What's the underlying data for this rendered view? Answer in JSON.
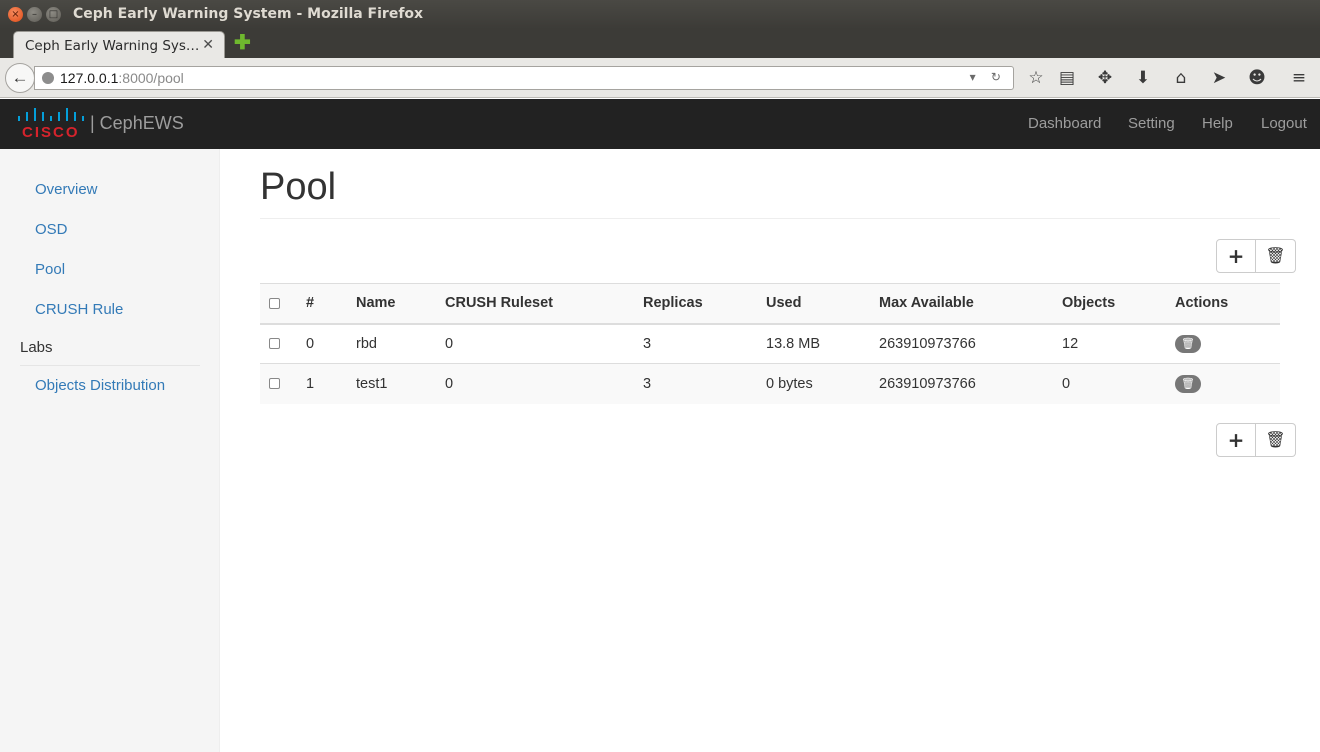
{
  "window": {
    "title": "Ceph Early Warning System - Mozilla Firefox"
  },
  "browser": {
    "tab_title": "Ceph Early Warning Sys…",
    "url_host": "127.0.0.1",
    "url_rest": ":8000/pool",
    "icons": [
      "back-arrow-icon",
      "globe-icon",
      "dropdown-icon",
      "reload-icon",
      "bookmark-star-icon",
      "reading-list-icon",
      "pocket-icon",
      "download-icon",
      "home-icon",
      "send-icon",
      "chat-icon",
      "menu-icon"
    ]
  },
  "app": {
    "brand_logo_text": "CISCO",
    "brand_name": "| CephEWS",
    "top_nav": [
      "Dashboard",
      "Setting",
      "Help",
      "Logout"
    ]
  },
  "sidebar": {
    "items": [
      "Overview",
      "OSD",
      "Pool",
      "CRUSH Rule"
    ],
    "section_header": "Labs",
    "lab_items": [
      "Objects Distribution"
    ]
  },
  "main": {
    "title": "Pool",
    "add_glyph": "+",
    "delete_glyph": "🗑",
    "table": {
      "headers": [
        "#",
        "Name",
        "CRUSH Ruleset",
        "Replicas",
        "Used",
        "Max Available",
        "Objects",
        "Actions"
      ],
      "rows": [
        {
          "id": "0",
          "name": "rbd",
          "ruleset": "0",
          "replicas": "3",
          "used": "13.8 MB",
          "max_available": "263910973766",
          "objects": "12"
        },
        {
          "id": "1",
          "name": "test1",
          "ruleset": "0",
          "replicas": "3",
          "used": "0 bytes",
          "max_available": "263910973766",
          "objects": "0"
        }
      ]
    }
  },
  "colors": {
    "header_bg": "#222222",
    "link": "#337ab7",
    "cisco_red": "#d6232c",
    "cisco_blue": "#049fd9"
  }
}
